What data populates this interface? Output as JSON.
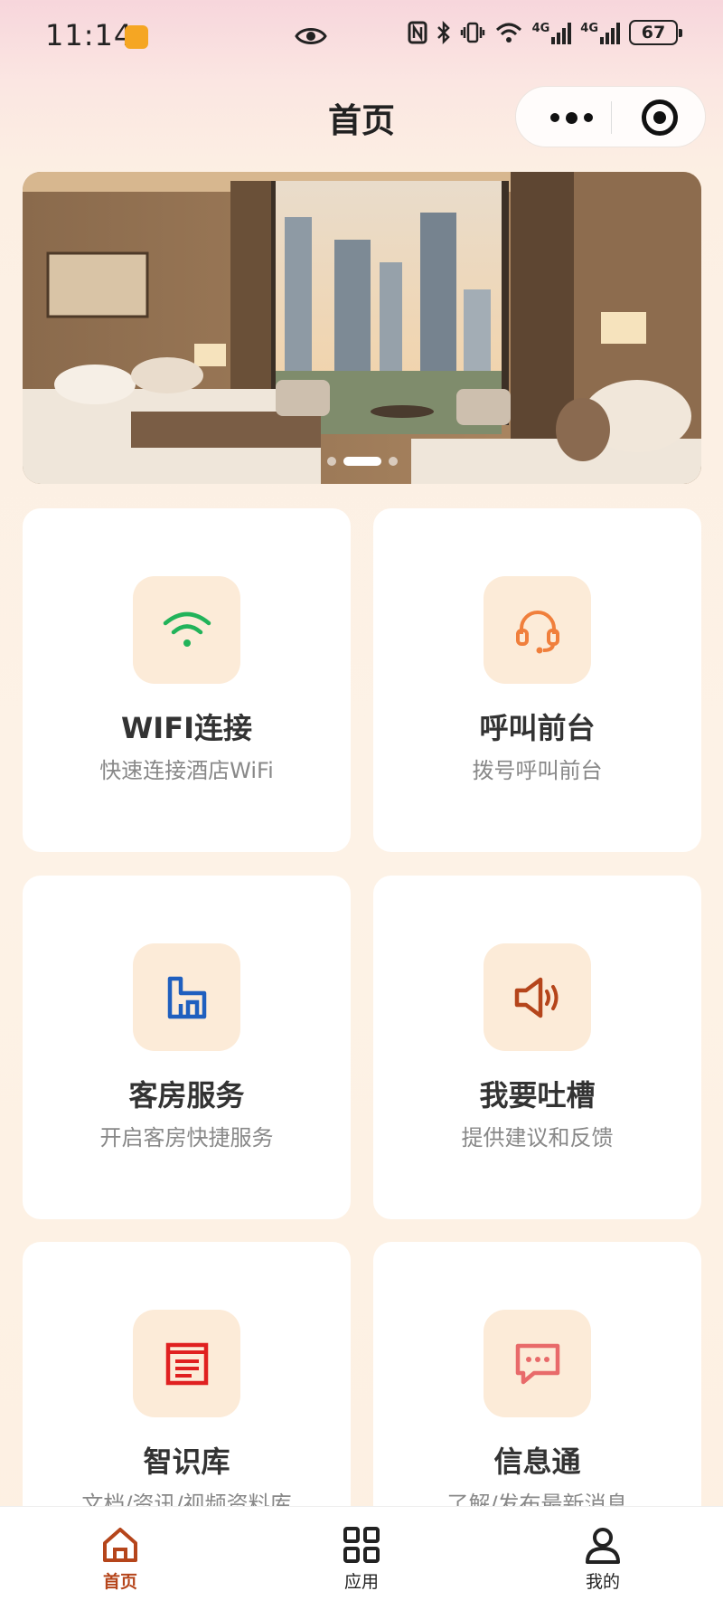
{
  "status_bar": {
    "time": "11:14",
    "battery": "67",
    "signal_1": "4G",
    "signal_2": "4G"
  },
  "nav": {
    "title": "首页"
  },
  "banner": {
    "slide_count": 3,
    "active_slide": 2
  },
  "services": [
    {
      "title": "WIFI连接",
      "subtitle": "快速连接酒店WiFi",
      "icon": "wifi-icon",
      "icon_color": "#22b35a"
    },
    {
      "title": "呼叫前台",
      "subtitle": "拨号呼叫前台",
      "icon": "headset-icon",
      "icon_color": "#f07f3c"
    },
    {
      "title": "客房服务",
      "subtitle": "开启客房快捷服务",
      "icon": "building-icon",
      "icon_color": "#1f5fbf"
    },
    {
      "title": "我要吐槽",
      "subtitle": "提供建议和反馈",
      "icon": "speaker-icon",
      "icon_color": "#b5451b"
    },
    {
      "title": "智识库",
      "subtitle": "文档/资讯/视频资料库",
      "icon": "document-icon",
      "icon_color": "#e02020"
    },
    {
      "title": "信息通",
      "subtitle": "了解/发布最新消息",
      "icon": "chat-bubble-icon",
      "icon_color": "#e86a6a"
    }
  ],
  "tabbar": {
    "items": [
      {
        "label": "首页",
        "icon": "home-icon",
        "active": true
      },
      {
        "label": "应用",
        "icon": "apps-grid-icon",
        "active": false
      },
      {
        "label": "我的",
        "icon": "user-icon",
        "active": false
      }
    ],
    "active_color": "#b5451b"
  }
}
